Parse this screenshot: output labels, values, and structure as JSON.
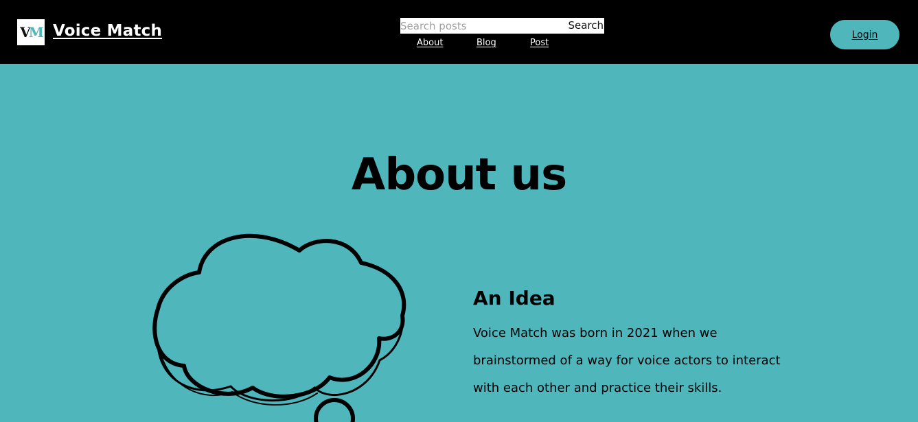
{
  "header": {
    "logo_text_v": "V",
    "logo_text_m": "M",
    "brand": "Voice Match",
    "search": {
      "placeholder": "Search posts",
      "button_label": "Search"
    },
    "nav": [
      {
        "label": "About"
      },
      {
        "label": "Blog"
      },
      {
        "label": "Post"
      }
    ],
    "login_label": "Login"
  },
  "main": {
    "title": "About us",
    "section": {
      "heading": "An Idea",
      "body": "Voice Match was born in 2021 when we brainstormed of a way for voice actors to interact with each other and practice their skills."
    }
  },
  "colors": {
    "accent": "#4fb6bc",
    "header_bg": "#000000"
  },
  "icons": {
    "illustration": "thought-bubble-icon"
  }
}
